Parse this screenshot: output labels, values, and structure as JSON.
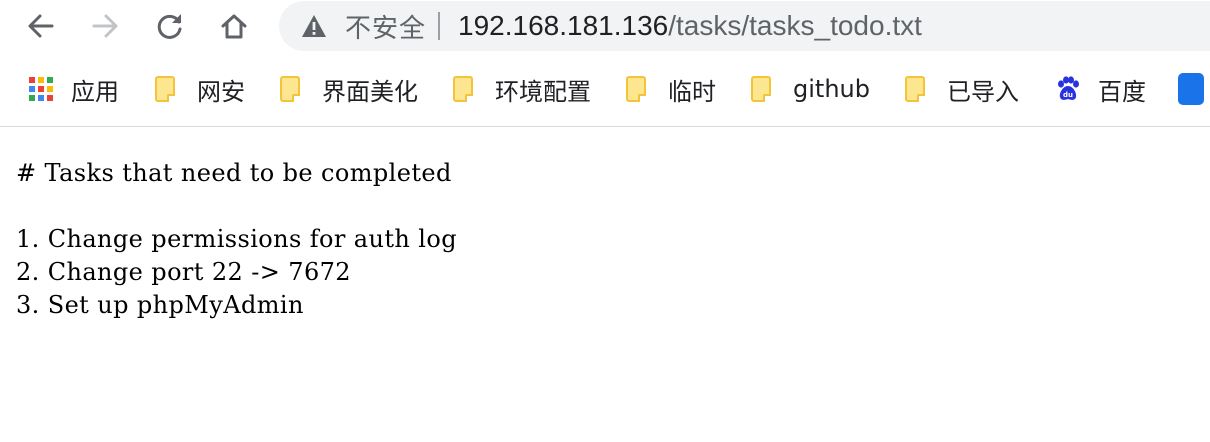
{
  "browser": {
    "security_label": "不安全",
    "url_host": "192.168.181.136",
    "url_path": "/tasks/tasks_todo.txt",
    "icons": {
      "back": "arrow-left-icon",
      "forward": "arrow-right-icon",
      "reload": "reload-icon",
      "home": "home-icon",
      "security": "warning-triangle-icon"
    }
  },
  "bookmarks": {
    "items": [
      {
        "label": "应用",
        "icon": "apps-grid-icon"
      },
      {
        "label": "网安",
        "icon": "folder-icon"
      },
      {
        "label": "界面美化",
        "icon": "folder-icon"
      },
      {
        "label": "环境配置",
        "icon": "folder-icon"
      },
      {
        "label": "临时",
        "icon": "folder-icon"
      },
      {
        "label": "github",
        "icon": "folder-icon"
      },
      {
        "label": "已导入",
        "icon": "folder-icon"
      },
      {
        "label": "百度",
        "icon": "baidu-paw-icon"
      }
    ]
  },
  "document": {
    "lines": [
      "# Tasks that need to be completed",
      "",
      "1. Change permissions for auth log",
      "2. Change port 22 -> 7672",
      "3. Set up phpMyAdmin"
    ]
  },
  "colors": {
    "omnibox_bg": "#f1f3f4",
    "folder_fill": "#fce68f",
    "folder_stroke": "#f3c43a",
    "baidu_blue": "#2932e1"
  }
}
